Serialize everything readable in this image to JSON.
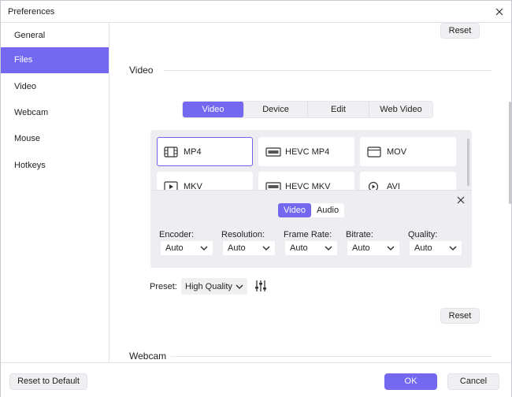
{
  "window": {
    "title": "Preferences"
  },
  "sidebar": {
    "items": [
      {
        "label": "General",
        "active": false
      },
      {
        "label": "Files",
        "active": true
      },
      {
        "label": "Video",
        "active": false
      },
      {
        "label": "Webcam",
        "active": false
      },
      {
        "label": "Mouse",
        "active": false
      },
      {
        "label": "Hotkeys",
        "active": false
      }
    ]
  },
  "content": {
    "reset_top_label": "Reset",
    "video_section": {
      "title": "Video",
      "tabs": [
        "Video",
        "Device",
        "Edit",
        "Web Video"
      ],
      "active_tab": "Video",
      "formats": [
        {
          "label": "MP4",
          "icon": "film-icon",
          "selected": true
        },
        {
          "label": "HEVC MP4",
          "icon": "hevc-icon",
          "selected": false
        },
        {
          "label": "MOV",
          "icon": "clapper-icon",
          "selected": false
        },
        {
          "label": "MKV",
          "icon": "play-box-icon",
          "selected": false
        },
        {
          "label": "HEVC MKV",
          "icon": "hevc-icon",
          "selected": false
        },
        {
          "label": "AVI",
          "icon": "play-circle-icon",
          "selected": false
        }
      ]
    },
    "settings": {
      "subtabs": [
        "Video",
        "Audio"
      ],
      "active_subtab": "Video",
      "fields": [
        {
          "label": "Encoder:",
          "value": "Auto"
        },
        {
          "label": "Resolution:",
          "value": "Auto"
        },
        {
          "label": "Frame Rate:",
          "value": "Auto"
        },
        {
          "label": "Bitrate:",
          "value": "Auto"
        },
        {
          "label": "Quality:",
          "value": "Auto"
        }
      ]
    },
    "preset": {
      "label": "Preset:",
      "value": "High Quality"
    },
    "reset_bottom_label": "Reset",
    "webcam_section": {
      "title": "Webcam"
    }
  },
  "footer": {
    "reset_default_label": "Reset to Default",
    "ok_label": "OK",
    "cancel_label": "Cancel"
  },
  "colors": {
    "accent": "#7468f0",
    "panel": "#eeeef2"
  }
}
